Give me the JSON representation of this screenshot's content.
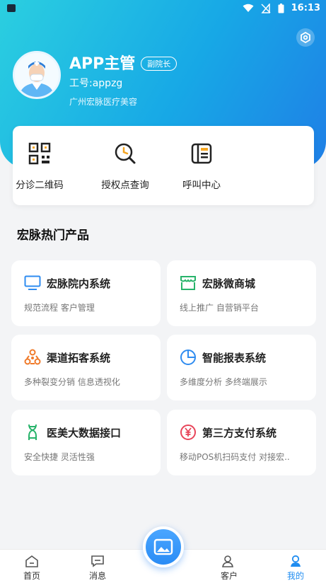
{
  "status_bar": {
    "time": "16:13"
  },
  "profile": {
    "name": "APP主管",
    "role_badge": "副院长",
    "employee_id": "工号:appzg",
    "company": "广州宏脉医疗美容"
  },
  "quick_actions": [
    {
      "label": "分诊二维码",
      "icon": "qrcode-icon"
    },
    {
      "label": "授权点查询",
      "icon": "search-clock-icon"
    },
    {
      "label": "呼叫中心",
      "icon": "call-center-icon"
    }
  ],
  "section": {
    "title": "宏脉热门产品"
  },
  "products": [
    {
      "title": "宏脉院内系统",
      "desc": "规范流程 客户管理",
      "icon": "monitor-icon",
      "color": "#2f8cf0"
    },
    {
      "title": "宏脉微商城",
      "desc": "线上推广 自营销平台",
      "icon": "shop-icon",
      "color": "#27b36a"
    },
    {
      "title": "渠道拓客系统",
      "desc": "多种裂变分销 信息透视化",
      "icon": "network-icon",
      "color": "#f07a2a"
    },
    {
      "title": "智能报表系统",
      "desc": "多维度分析 多终端展示",
      "icon": "pie-chart-icon",
      "color": "#2f8cf0"
    },
    {
      "title": "医美大数据接口",
      "desc": "安全快捷 灵活性强",
      "icon": "dna-icon",
      "color": "#27b36a"
    },
    {
      "title": "第三方支付系统",
      "desc": "移动POS机扫码支付 对接宏..",
      "icon": "yen-icon",
      "color": "#e8455a"
    }
  ],
  "tabbar": {
    "items": [
      {
        "label": "首页",
        "icon": "home-icon"
      },
      {
        "label": "消息",
        "icon": "message-icon"
      },
      {
        "label": "客户",
        "icon": "customer-icon"
      },
      {
        "label": "我的",
        "icon": "user-icon"
      }
    ],
    "active": "我的",
    "center_icon": "image-icon",
    "accent": "#1f8cf0"
  },
  "colors": {
    "header_start": "#2bcfe0",
    "header_end": "#1f7fe6"
  }
}
